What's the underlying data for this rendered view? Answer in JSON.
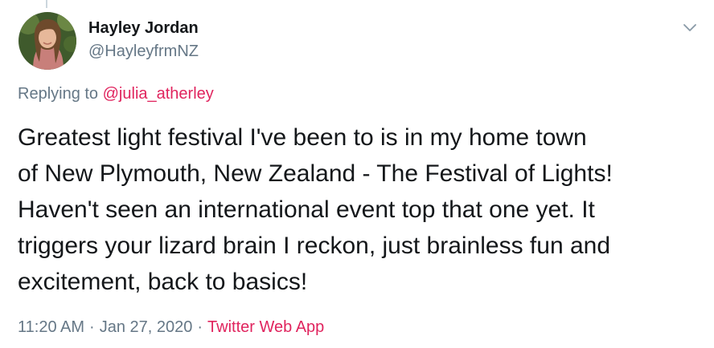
{
  "author": {
    "display_name": "Hayley Jordan",
    "handle": "@HayleyfrmNZ",
    "avatar_icon": "profile-photo"
  },
  "reply": {
    "prefix": "Replying to ",
    "mention": "@julia_atherley"
  },
  "tweet": {
    "text": "Greatest light festival I've been to is in my home town\nof New Plymouth, New Zealand - The Festival of Lights!\nHaven't seen an international event top that one yet. It\ntriggers your lizard brain I reckon, just brainless fun and\nexcitement, back to basics!"
  },
  "meta": {
    "time": "11:20 AM",
    "separator": "·",
    "date": "Jan 27, 2020",
    "source": "Twitter Web App"
  },
  "menu": {
    "icon": "chevron-down-icon"
  },
  "colors": {
    "accent": "#e0245e",
    "secondary_text": "#657786",
    "primary_text": "#14171a"
  }
}
